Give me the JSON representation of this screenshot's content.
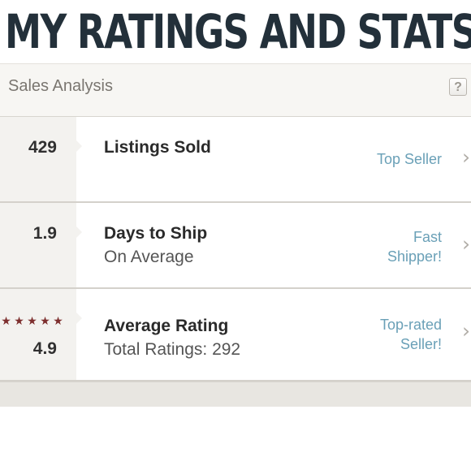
{
  "banner": {
    "title": "MY RATINGS AND STATS"
  },
  "panel": {
    "title": "Sales Analysis",
    "help_icon": "question-mark-icon",
    "help_label": "?"
  },
  "rows": [
    {
      "value": "429",
      "label": "Listings Sold",
      "sublabel": "",
      "badge_lines": [
        "Top Seller"
      ],
      "chevron_icon": "chevron-right-icon"
    },
    {
      "value": "1.9",
      "label": "Days to Ship",
      "sublabel": "On Average",
      "badge_lines": [
        "Fast",
        "Shipper!"
      ],
      "chevron_icon": "chevron-right-icon"
    },
    {
      "value": "4.9",
      "label": "Average Rating",
      "sublabel": "Total Ratings: 292",
      "stars": 5,
      "badge_lines": [
        "Top-rated",
        "Seller!"
      ],
      "chevron_icon": "chevron-right-icon"
    }
  ],
  "colors": {
    "banner_text": "#23303a",
    "badge_link": "#6aa0b7",
    "rating_stars": "#7d2f2e",
    "panel_background": "#f6f5f2"
  }
}
